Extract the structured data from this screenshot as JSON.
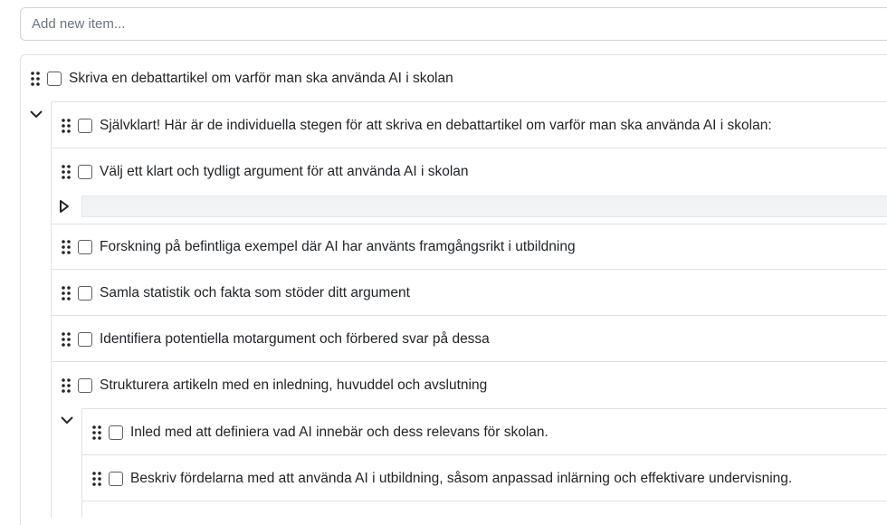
{
  "add_item": {
    "placeholder": "Add new item..."
  },
  "items": {
    "root": "Skriva en debattartikel om varför man ska använda AI i skolan",
    "child_1": "Självklart! Här är de individuella stegen för att skriva en debattartikel om varför man ska använda AI i skolan:",
    "child_2": "Välj ett klart och tydligt argument för att använda AI i skolan",
    "child_3": "Forskning på befintliga exempel där AI har använts framgångsrikt i utbildning",
    "child_4": "Samla statistik och fakta som stöder ditt argument",
    "child_5": "Identifiera potentiella motargument och förbered svar på dessa",
    "child_6": "Strukturera artikeln med en inledning, huvuddel och avslutning",
    "grandchild_1": "Inled med att definiera vad AI innebär och dess relevans för skolan.",
    "grandchild_2": "Beskriv fördelarna med att använda AI i utbildning, såsom anpassad inlärning och effektivare undervisning."
  },
  "icons": {
    "drag_handle": "grip-vertical-icon",
    "expanded": "chevron-down-icon",
    "collapsed": "caret-right-icon"
  }
}
